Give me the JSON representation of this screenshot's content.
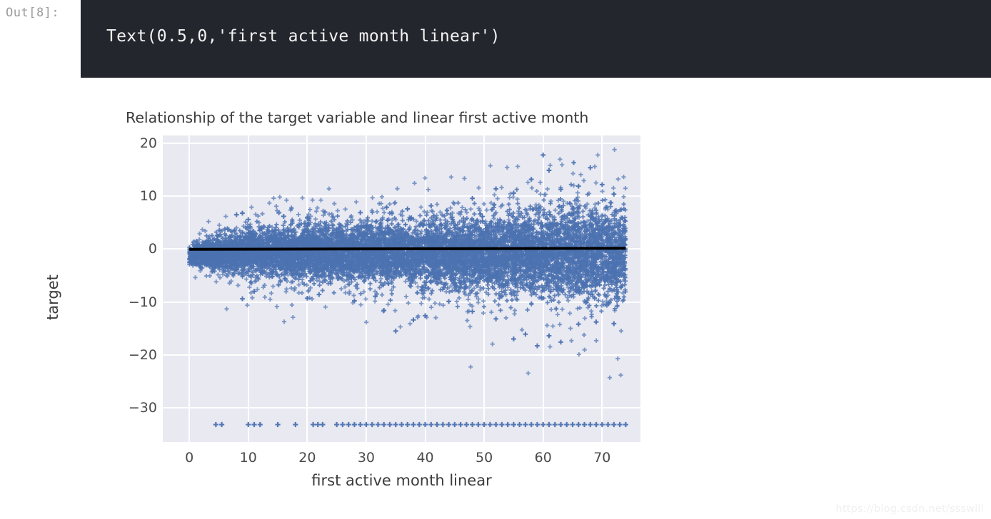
{
  "notebook": {
    "prompt": "Out[8]:",
    "output_text": "Text(0.5,0,'first active month linear')",
    "cell_bg": "#24262d",
    "prompt_color": "#9b9b9b"
  },
  "watermark": {
    "text": "https://blog.csdn.net/ssswill"
  },
  "chart_data": {
    "type": "scatter",
    "title": "Relationship of the target variable and linear first active month",
    "xlabel": "first active month linear",
    "ylabel": "target",
    "xlim": [
      -4.5,
      76.5
    ],
    "ylim": [
      -36.5,
      21.5
    ],
    "xticks": [
      0,
      10,
      20,
      30,
      40,
      50,
      60,
      70
    ],
    "yticks": [
      20,
      10,
      0,
      -10,
      -20,
      -30
    ],
    "grid": true,
    "legend": null,
    "marker": "plus",
    "point_color": "#4c72b0",
    "axes_bg": "#e9e9f2",
    "grid_color": "#ffffff",
    "regression_line": {
      "color": "#000000",
      "x_start": 0,
      "x_end": 74,
      "y_start": -0.05,
      "y_end": 0.15,
      "description": "near-flat black linear fit at target ~ 0"
    },
    "series": [
      {
        "name": "target vs first active month linear",
        "description": "dense fan-shaped cloud of plus markers centered on target=0; spread widens from x=0 to x=74",
        "x_range": [
          0,
          74
        ],
        "bulk_band_by_x": [
          {
            "x": 0,
            "y_low": -3.2,
            "y_high": 0.8
          },
          {
            "x": 5,
            "y_low": -4.5,
            "y_high": 3.0
          },
          {
            "x": 10,
            "y_low": -5.5,
            "y_high": 4.5
          },
          {
            "x": 15,
            "y_low": -6.0,
            "y_high": 5.0
          },
          {
            "x": 20,
            "y_low": -6.5,
            "y_high": 5.2
          },
          {
            "x": 25,
            "y_low": -7.0,
            "y_high": 5.5
          },
          {
            "x": 30,
            "y_low": -7.2,
            "y_high": 5.8
          },
          {
            "x": 35,
            "y_low": -7.5,
            "y_high": 6.0
          },
          {
            "x": 40,
            "y_low": -8.0,
            "y_high": 6.2
          },
          {
            "x": 45,
            "y_low": -8.5,
            "y_high": 6.6
          },
          {
            "x": 50,
            "y_low": -9.0,
            "y_high": 7.2
          },
          {
            "x": 55,
            "y_low": -9.6,
            "y_high": 8.0
          },
          {
            "x": 60,
            "y_low": -10.2,
            "y_high": 8.6
          },
          {
            "x": 65,
            "y_low": -10.6,
            "y_high": 9.0
          },
          {
            "x": 70,
            "y_low": -11.0,
            "y_high": 9.2
          },
          {
            "x": 74,
            "y_low": -11.4,
            "y_high": 9.4
          }
        ],
        "notable_outliers": [
          {
            "x": 8,
            "y": 6.5
          },
          {
            "x": 9,
            "y": 6.8
          },
          {
            "x": 10,
            "y": 5.6
          },
          {
            "x": 16,
            "y": 6.2
          },
          {
            "x": 20,
            "y": 5.9
          },
          {
            "x": 23,
            "y": 7.0
          },
          {
            "x": 29,
            "y": 6.9
          },
          {
            "x": 37,
            "y": 7.6
          },
          {
            "x": 41,
            "y": 8.2
          },
          {
            "x": 48,
            "y": 9.6
          },
          {
            "x": 52,
            "y": 11.4
          },
          {
            "x": 55,
            "y": 10.6
          },
          {
            "x": 58,
            "y": 13.2
          },
          {
            "x": 60,
            "y": 17.8
          },
          {
            "x": 61,
            "y": 14.9
          },
          {
            "x": 63,
            "y": 11.3
          },
          {
            "x": 66,
            "y": 11.9
          },
          {
            "x": 68,
            "y": 15.4
          },
          {
            "x": 70,
            "y": 12.2
          },
          {
            "x": 72,
            "y": 10.4
          },
          {
            "x": 9,
            "y": -9.4
          },
          {
            "x": 11,
            "y": -8.0
          },
          {
            "x": 20,
            "y": -9.3
          },
          {
            "x": 22,
            "y": -8.6
          },
          {
            "x": 28,
            "y": -9.8
          },
          {
            "x": 33,
            "y": -11.6
          },
          {
            "x": 35,
            "y": -15.5
          },
          {
            "x": 38,
            "y": -13.4
          },
          {
            "x": 40,
            "y": -12.6
          },
          {
            "x": 44,
            "y": -9.9
          },
          {
            "x": 48,
            "y": -11.8
          },
          {
            "x": 52,
            "y": -13.2
          },
          {
            "x": 55,
            "y": -17.0
          },
          {
            "x": 57,
            "y": -16.1
          },
          {
            "x": 59,
            "y": -18.3
          },
          {
            "x": 61,
            "y": -16.4
          },
          {
            "x": 63,
            "y": -17.6
          },
          {
            "x": 66,
            "y": -14.2
          },
          {
            "x": 69,
            "y": -13.8
          },
          {
            "x": 72,
            "y": -14.1
          }
        ],
        "floor_outlier_value": -33.2,
        "floor_outlier_x": [
          4.5,
          5.5,
          10,
          11,
          12,
          15,
          18,
          21,
          21.8,
          22.6,
          25,
          26,
          27,
          28,
          29,
          30,
          31,
          32,
          33,
          34,
          35,
          36,
          37,
          38,
          39,
          40,
          41,
          42,
          43,
          44,
          45,
          46,
          47,
          48,
          49,
          50,
          51,
          52,
          53,
          54,
          55,
          56,
          57,
          58,
          59,
          60,
          61,
          62,
          63,
          64,
          65,
          66,
          67,
          68,
          69,
          70,
          71,
          72,
          73,
          74
        ]
      }
    ]
  }
}
